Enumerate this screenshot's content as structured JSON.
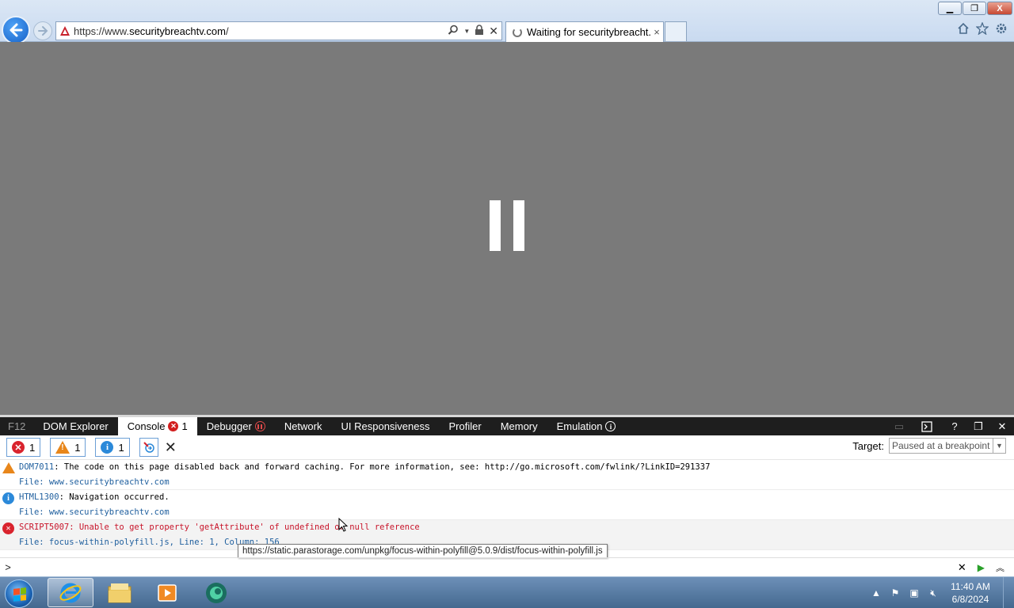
{
  "browser": {
    "url_prefix": "https://www.",
    "url_domain": "securitybreachtv.com",
    "url_suffix": "/",
    "tab_title": "Waiting for securitybreacht...",
    "tab_close": "×",
    "window_buttons": {
      "minimize": "▁",
      "restore": "❐",
      "close": "X"
    }
  },
  "devtools": {
    "tabs": {
      "f12": "F12",
      "dom_explorer": "DOM Explorer",
      "console": "Console",
      "console_count": "1",
      "debugger": "Debugger",
      "network": "Network",
      "ui_responsiveness": "UI Responsiveness",
      "profiler": "Profiler",
      "memory": "Memory",
      "emulation": "Emulation"
    },
    "filters": {
      "errors": "1",
      "warnings": "1",
      "info": "1"
    },
    "target_label": "Target:",
    "target_value": "Paused at a breakpoint",
    "messages": [
      {
        "type": "warning",
        "code": "DOM7011",
        "text": ": The code on this page disabled back and forward caching. For more information, see: http://go.microsoft.com/fwlink/?LinkID=291337",
        "file": "File: www.securitybreachtv.com"
      },
      {
        "type": "info",
        "code": "HTML1300",
        "text": ": Navigation occurred.",
        "file": "File: www.securitybreachtv.com"
      },
      {
        "type": "error",
        "code": "SCRIPT5007",
        "text": ": Unable to get property 'getAttribute' of undefined or null reference",
        "file": "File: focus-within-polyfill.js, Line: 1, Column: 156"
      }
    ],
    "tooltip": "https://static.parastorage.com/unpkg/focus-within-polyfill@5.0.9/dist/focus-within-polyfill.js",
    "prompt": ">"
  },
  "taskbar": {
    "time": "11:40 AM",
    "date": "6/8/2024"
  },
  "colors": {
    "page_background": "#7a7a7a",
    "devtools_tabbar": "#1e1e1e",
    "error": "#d9232d",
    "warning": "#e8861a",
    "info": "#2b89d9"
  }
}
